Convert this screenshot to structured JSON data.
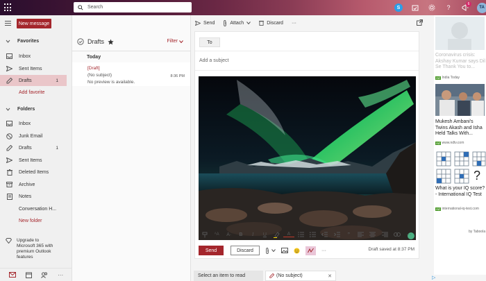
{
  "search": {
    "placeholder": "Search"
  },
  "topbar": {
    "skype_icon": "S",
    "notification_count": "6",
    "avatar_initials": "TA"
  },
  "left_nav": {
    "new_message": "New message",
    "favorites_label": "Favorites",
    "favorites": [
      {
        "label": "Inbox",
        "count": ""
      },
      {
        "label": "Sent Items",
        "count": ""
      },
      {
        "label": "Drafts",
        "count": "1"
      }
    ],
    "add_favorite": "Add favorite",
    "folders_label": "Folders",
    "folders": [
      {
        "label": "Inbox",
        "count": ""
      },
      {
        "label": "Junk Email",
        "count": ""
      },
      {
        "label": "Drafts",
        "count": "1"
      },
      {
        "label": "Sent Items",
        "count": ""
      },
      {
        "label": "Deleted Items",
        "count": ""
      },
      {
        "label": "Archive",
        "count": ""
      },
      {
        "label": "Notes",
        "count": ""
      },
      {
        "label": "Conversation H...",
        "count": ""
      }
    ],
    "new_folder": "New folder",
    "upgrade": [
      "Upgrade to",
      "Microsoft 365 with",
      "premium Outlook",
      "features"
    ]
  },
  "message_list": {
    "title": "Drafts",
    "filter": "Filter",
    "group": "Today",
    "items": [
      {
        "tag": "[Draft]",
        "subject": "(No subject)",
        "preview": "No preview is available.",
        "time": "8:36 PM"
      }
    ]
  },
  "compose_toolbar": {
    "send": "Send",
    "attach": "Attach",
    "discard": "Discard",
    "more": "···"
  },
  "compose": {
    "to_label": "To",
    "subject_placeholder": "Add a subject",
    "send_label": "Send",
    "discard_label": "Discard",
    "saved_status": "Draft saved at 8:37 PM",
    "more": "···",
    "format_more": "···"
  },
  "bottom_tabs": {
    "read": "Select an item to read",
    "draft": "(No subject)"
  },
  "ads": {
    "ad1": {
      "headline": "Coronavirus crisis: Akshay Kumar says Dil Se Thank You to...",
      "source": "India Today"
    },
    "ad2": {
      "headline": "Mukesh Ambani's Twins Akash and Isha Held Talks With...",
      "source": "www.ndtv.com"
    },
    "ad3": {
      "headline": "What is your IQ score? - International IQ Test",
      "source": "international-iq-test.com",
      "glyph": "?"
    },
    "ad_label": "Ad",
    "provider": "by Taboola"
  }
}
